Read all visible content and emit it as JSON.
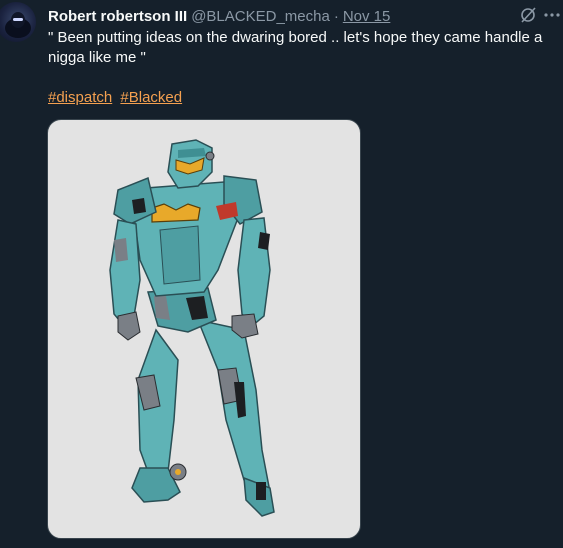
{
  "tweet": {
    "author_name": "Robert robertson III",
    "handle": "@BLACKED_mecha",
    "separator": "·",
    "date": "Nov 15",
    "text": "\" Been putting ideas on the dwaring bored ..  let's hope they came handle a nigga like me \"",
    "hashtags": [
      "#dispatch",
      "#Blacked"
    ],
    "media_alt": "Illustration of a teal armored mech suit standing"
  },
  "icons": {
    "grok": "grok-icon",
    "more": "more-icon"
  },
  "colors": {
    "background": "#15202b",
    "text_primary": "#f7f9f9",
    "text_secondary": "#8b98a5",
    "hashtag": "#f4a050",
    "mech_teal": "#5fb3b6",
    "mech_accent": "#e8a92a"
  }
}
